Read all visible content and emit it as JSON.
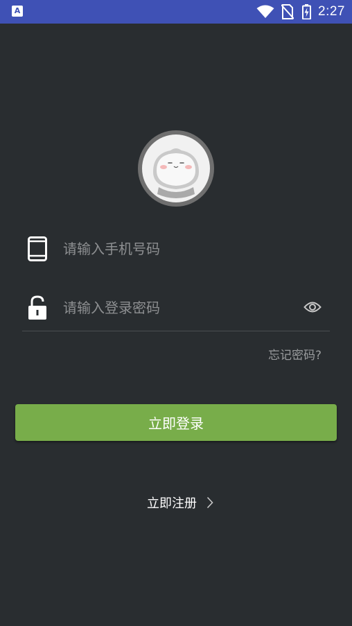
{
  "status_bar": {
    "app_icon_letter": "A",
    "time": "2:27",
    "icons": [
      "wifi-icon",
      "no-sim-icon",
      "battery-charging-icon"
    ],
    "background_color": "#3f51b5"
  },
  "avatar": {
    "icon": "cartoon-face-avatar"
  },
  "form": {
    "phone_placeholder": "请输入手机号码",
    "phone_value": "",
    "phone_icon": "smartphone-icon",
    "password_placeholder": "请输入登录密码",
    "password_value": "",
    "password_icon": "lock-icon",
    "toggle_icon": "eye-icon",
    "forgot_label": "忘记密码?"
  },
  "actions": {
    "login_label": "立即登录",
    "register_label": "立即注册",
    "register_icon": "chevron-right-icon"
  },
  "colors": {
    "background": "#292d30",
    "accent_green": "#78ad4a",
    "placeholder": "#8d8f91"
  }
}
